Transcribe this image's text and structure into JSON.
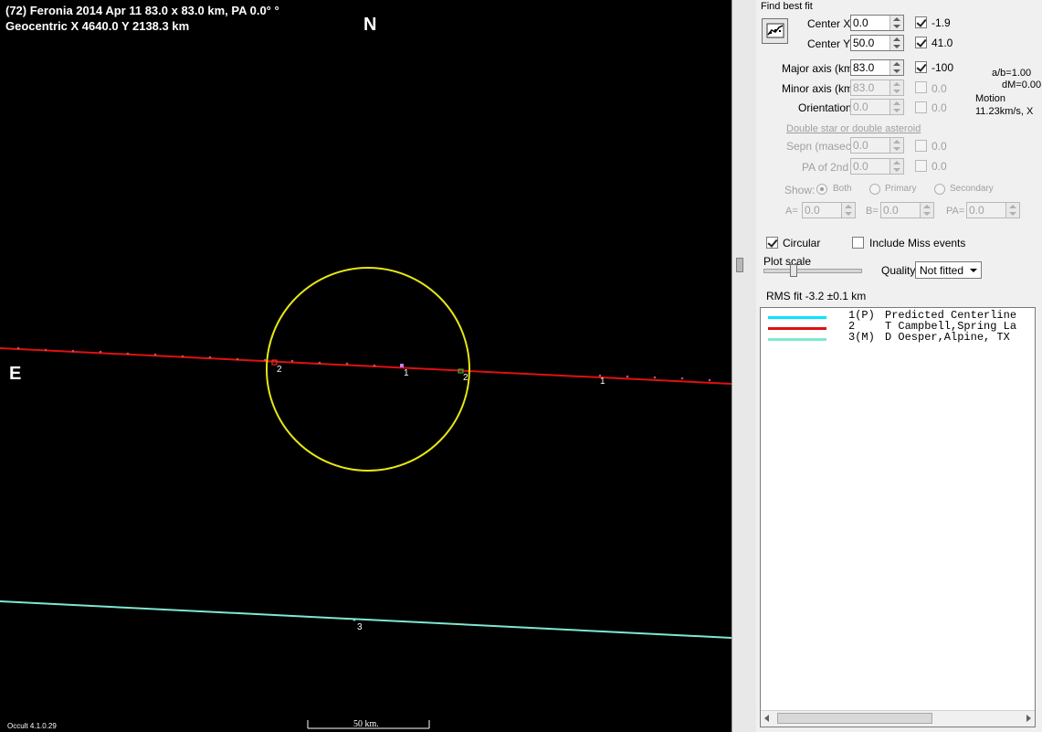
{
  "plot": {
    "title_line1": "(72) Feronia  2014 Apr 11   83.0 x 83.0 km, PA 0.0° °",
    "title_line2": "Geocentric  X  4640.0  Y 2138.3 km",
    "north_label": "N",
    "east_label": "E",
    "chord_labels": {
      "red_left_2": "2",
      "center_1": "1",
      "red_right_2": "2",
      "right_1": "1",
      "cyan_3": "3"
    },
    "scale_label": "50 km.",
    "version": "Occult 4.1.0.29",
    "colors": {
      "background": "#000000",
      "ellipse": "#e6e614",
      "chord_red": "#e01010",
      "chord_aqua": "#7fe8d0"
    }
  },
  "panel": {
    "find_best_fit": "Find best fit",
    "center_x": {
      "label": "Center X",
      "value": "0.0",
      "checked": true,
      "result": "-1.9"
    },
    "center_y": {
      "label": "Center Y",
      "value": "50.0",
      "checked": true,
      "result": "41.0"
    },
    "major_axis": {
      "label": "Major axis (km)",
      "value": "83.0",
      "checked": true,
      "result": "-100"
    },
    "minor_axis": {
      "label": "Minor axis (km)",
      "value": "83.0",
      "checked": false,
      "result": "0.0"
    },
    "orientation": {
      "label": "Orientation",
      "value": "0.0",
      "checked": false,
      "result": "0.0"
    },
    "ratio_ab": "a/b=1.00",
    "dm": "dM=0.00",
    "motion_label": "Motion",
    "motion_value": "11.23km/s, X",
    "double_star_link": "Double star  or  double asteroid",
    "sepn": {
      "label": "Sepn (masec)",
      "value": "0.0",
      "result": "0.0"
    },
    "pa2nd": {
      "label": "PA of 2nd",
      "value": "0.0",
      "result": "0.0"
    },
    "show_label": "Show:",
    "show_options": [
      "Both",
      "Primary",
      "Secondary"
    ],
    "a_label": "A=",
    "a_value": "0.0",
    "b_label": "B=",
    "b_value": "0.0",
    "pa_label": "PA=",
    "pa_value": "0.0",
    "circular_label": "Circular",
    "circular_checked": true,
    "include_miss_label": "Include Miss events",
    "include_miss_checked": false,
    "plot_scale_label": "Plot scale",
    "quality_label": "Quality",
    "quality_value": "Not fitted",
    "rms_fit": "RMS fit -3.2 ±0.1 km",
    "legend": [
      {
        "code": "1(P)",
        "text": "Predicted Centerline",
        "color": "#00e5ff"
      },
      {
        "code": "2",
        "text": "T Campbell,Spring La",
        "color": "#e01010"
      },
      {
        "code": "3(M)",
        "text": "D Oesper,Alpine, TX",
        "color": "#7fe8d0"
      }
    ]
  }
}
